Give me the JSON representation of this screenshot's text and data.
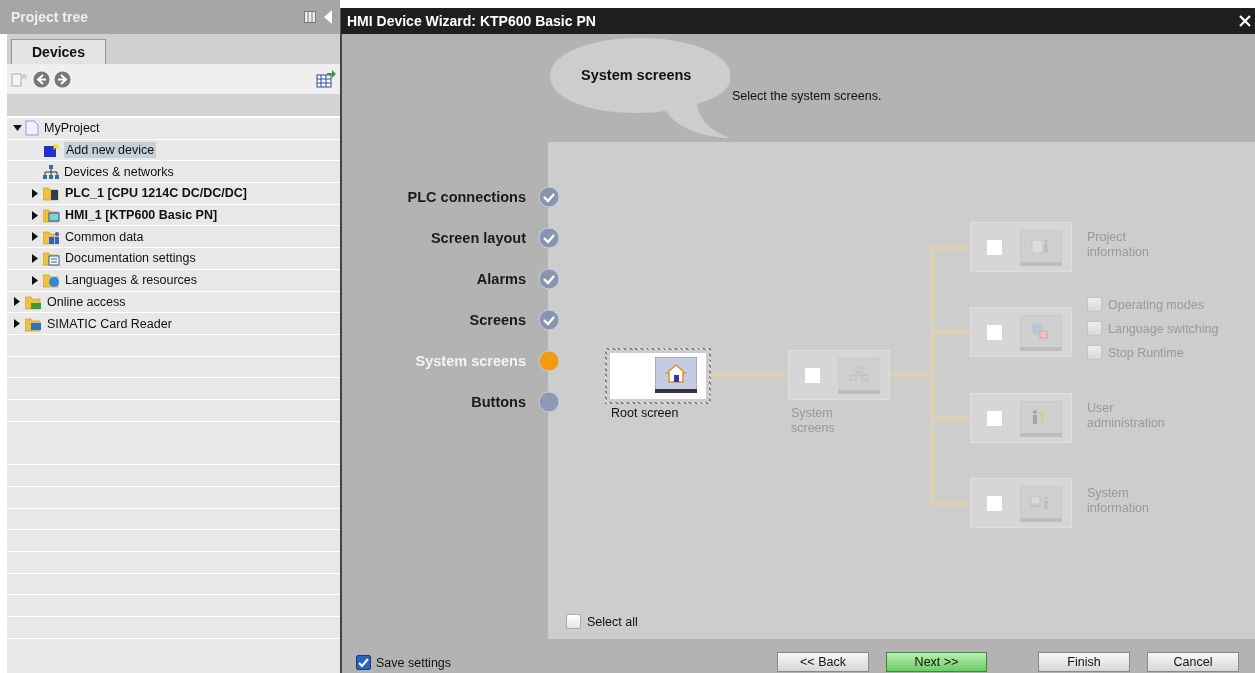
{
  "project_tree": {
    "title": "Project tree",
    "tabs": [
      {
        "label": "Devices",
        "selected": true
      }
    ],
    "items": [
      {
        "label": "MyProject",
        "kind": "project",
        "bold": false,
        "selected": false,
        "expanded": true,
        "children": [
          {
            "label": "Add new device",
            "kind": "add-device",
            "bold": false,
            "selected": true
          },
          {
            "label": "Devices & networks",
            "kind": "network",
            "bold": false,
            "selected": false
          },
          {
            "label": "PLC_1 [CPU 1214C DC/DC/DC]",
            "kind": "plc",
            "bold": true,
            "selected": false,
            "expanded": false
          },
          {
            "label": "HMI_1 [KTP600 Basic PN]",
            "kind": "hmi",
            "bold": true,
            "selected": false,
            "expanded": false
          },
          {
            "label": "Common data",
            "kind": "common",
            "bold": false,
            "selected": false,
            "expanded": false
          },
          {
            "label": "Documentation settings",
            "kind": "docs",
            "bold": false,
            "selected": false,
            "expanded": false
          },
          {
            "label": "Languages & resources",
            "kind": "languages",
            "bold": false,
            "selected": false,
            "expanded": false
          }
        ]
      },
      {
        "label": "Online access",
        "kind": "online",
        "bold": false,
        "selected": false,
        "expanded": false
      },
      {
        "label": "SIMATIC Card Reader",
        "kind": "card",
        "bold": false,
        "selected": false,
        "expanded": false
      }
    ]
  },
  "wizard": {
    "title": "HMI Device Wizard: KTP600 Basic PN",
    "header": {
      "bubble": "System screens",
      "description": "Select the system screens."
    },
    "steps": [
      {
        "label": "PLC connections",
        "kind": "done"
      },
      {
        "label": "Screen layout",
        "kind": "done"
      },
      {
        "label": "Alarms",
        "kind": "done"
      },
      {
        "label": "Screens",
        "kind": "done"
      },
      {
        "label": "System screens",
        "kind": "current"
      },
      {
        "label": "Buttons",
        "kind": "pending"
      }
    ],
    "diagram": {
      "root": {
        "label": "Root screen",
        "selected": true
      },
      "system_screens": {
        "label": "System screens",
        "checked": false,
        "disabled": true
      },
      "branches": [
        {
          "kind": "info-doc",
          "label": "Project information",
          "checked": false,
          "disabled": true
        },
        {
          "kind": "globe",
          "checked": false,
          "disabled": true,
          "options": [
            {
              "label": "Operating modes",
              "checked": false
            },
            {
              "label": "Language switching",
              "checked": false
            },
            {
              "label": "Stop Runtime",
              "checked": false
            }
          ]
        },
        {
          "kind": "users",
          "label": "User administration",
          "checked": false,
          "disabled": true
        },
        {
          "kind": "info-pc",
          "label": "System information",
          "checked": false,
          "disabled": true
        }
      ]
    },
    "select_all": {
      "label": "Select all",
      "checked": false
    },
    "save_settings": {
      "label": "Save settings",
      "checked": true
    },
    "buttons": [
      {
        "label": "<< Back",
        "kind": "normal"
      },
      {
        "label": "Next >>",
        "kind": "default"
      },
      {
        "label": "Finish",
        "kind": "normal"
      },
      {
        "label": "Cancel",
        "kind": "normal"
      }
    ]
  }
}
